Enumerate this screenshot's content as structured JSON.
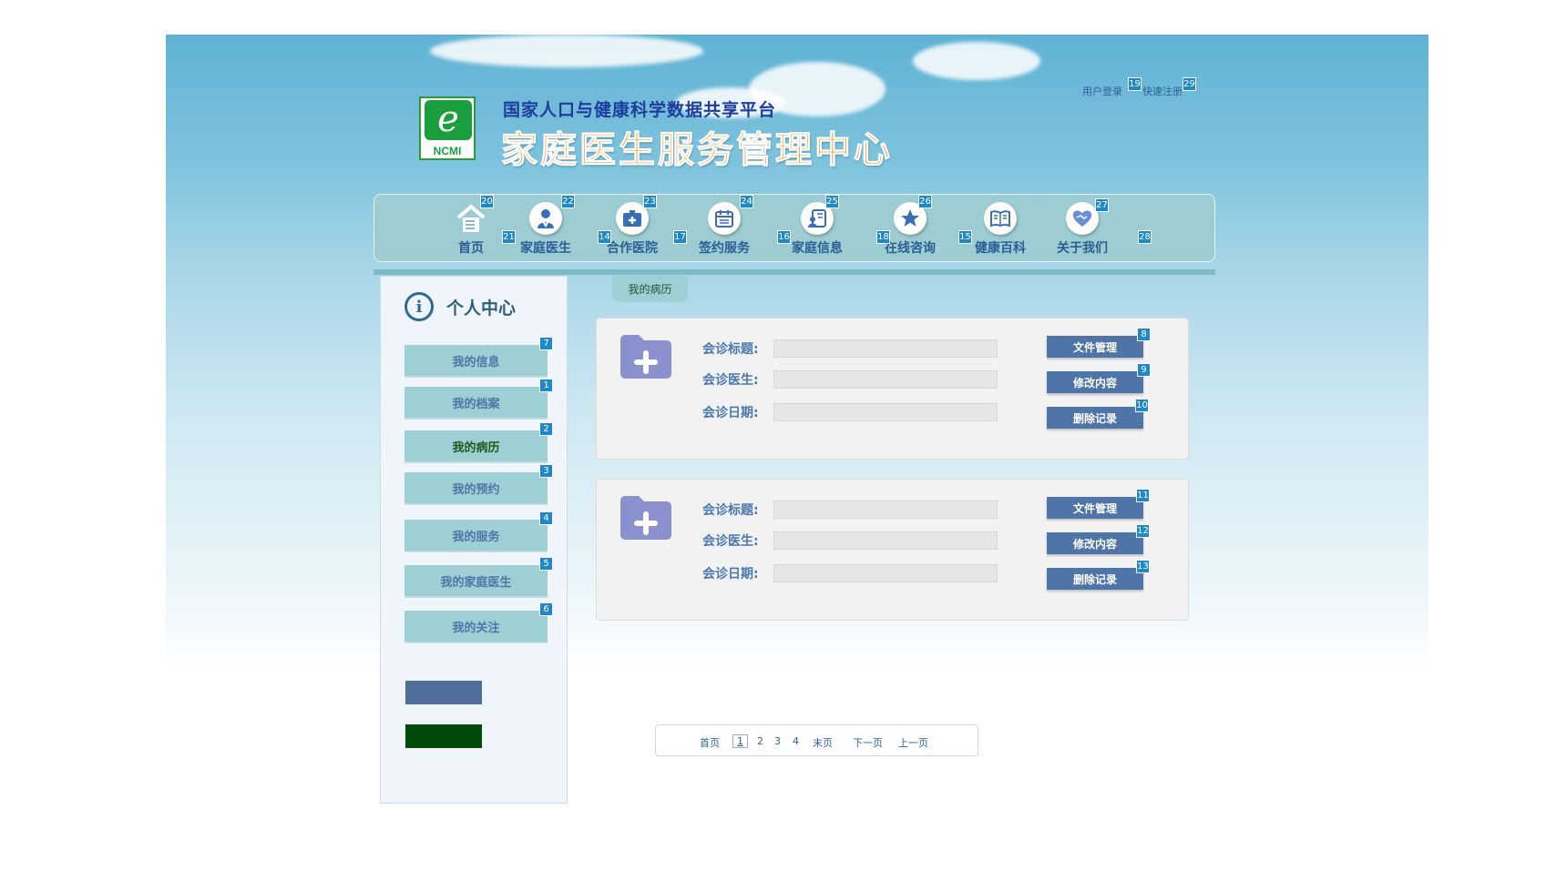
{
  "header": {
    "platform_name": "国家人口与健康科学数据共享平台",
    "site_title": "家庭医生服务管理中心",
    "logo_letter": "e",
    "logo_text": "NCMI",
    "login_link": "用户登录",
    "register_link": "快速注册"
  },
  "nav": {
    "items": [
      {
        "label": "首页",
        "icon": "home-icon"
      },
      {
        "label": "家庭医生",
        "icon": "doctor-icon"
      },
      {
        "label": "合作医院",
        "icon": "hospital-icon"
      },
      {
        "label": "签约服务",
        "icon": "calendar-icon"
      },
      {
        "label": "家庭信息",
        "icon": "id-card-icon"
      },
      {
        "label": "在线咨询",
        "icon": "star-icon"
      },
      {
        "label": "健康百科",
        "icon": "book-icon"
      },
      {
        "label": "关于我们",
        "icon": "handshake-icon"
      }
    ]
  },
  "sidebar": {
    "title": "个人中心",
    "items": [
      {
        "label": "我的信息"
      },
      {
        "label": "我的档案"
      },
      {
        "label": "我的病历",
        "active": true
      },
      {
        "label": "我的预约"
      },
      {
        "label": "我的服务"
      },
      {
        "label": "我的家庭医生"
      },
      {
        "label": "我的关注"
      }
    ]
  },
  "main": {
    "tab_label": "我的病历",
    "records": [
      {
        "title_label": "会诊标题:",
        "title_value": "",
        "doctor_label": "会诊医生:",
        "doctor_value": "",
        "date_label": "会诊日期:",
        "date_value": "",
        "files_button": "文件管理",
        "edit_button": "修改内容",
        "delete_button": "删除记录"
      },
      {
        "title_label": "会诊标题:",
        "title_value": "",
        "doctor_label": "会诊医生:",
        "doctor_value": "",
        "date_label": "会诊日期:",
        "date_value": "",
        "files_button": "文件管理",
        "edit_button": "修改内容",
        "delete_button": "删除记录"
      }
    ]
  },
  "pagination": {
    "first": "首页",
    "pages": [
      "1",
      "2",
      "3",
      "4"
    ],
    "current": "1",
    "last": "末页",
    "next": "下一页",
    "prev": "上一页"
  },
  "markers": {
    "m1": "1",
    "m2": "2",
    "m3": "3",
    "m4": "4",
    "m5": "5",
    "m6": "6",
    "m7": "7",
    "m8": "8",
    "m9": "9",
    "m10": "10",
    "m11": "11",
    "m12": "12",
    "m13": "13",
    "m14": "14",
    "m15": "15",
    "m16": "16",
    "m17": "17",
    "m18": "18",
    "m19": "19",
    "m20": "20",
    "m21": "21",
    "m22": "22",
    "m23": "23",
    "m24": "24",
    "m25": "25",
    "m26": "26",
    "m27": "27",
    "m28": "28",
    "m29": "29"
  },
  "colors": {
    "nav_bg": "#9dccd2",
    "sidebar_button": "#9ecfd4",
    "action_button": "#4e74a8",
    "title_orange": "#f0961a",
    "title_blue": "#1d3c9e"
  }
}
